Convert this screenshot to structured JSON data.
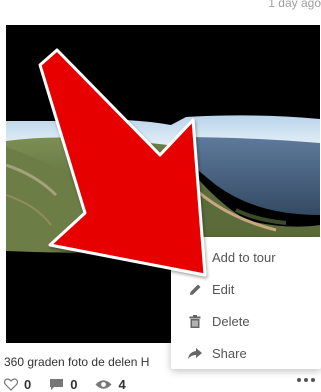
{
  "post": {
    "timestamp": "1 day ago",
    "caption": "360 graden foto de delen H",
    "likes": "0",
    "comments": "0",
    "views": "4"
  },
  "menu": {
    "items": [
      {
        "label": "Add to tour",
        "icon": "none"
      },
      {
        "label": "Edit",
        "icon": "pencil-icon"
      },
      {
        "label": "Delete",
        "icon": "trash-icon"
      },
      {
        "label": "Share",
        "icon": "share-arrow-icon"
      }
    ]
  },
  "colors": {
    "arrow": "#e60000",
    "text": "#555555"
  }
}
